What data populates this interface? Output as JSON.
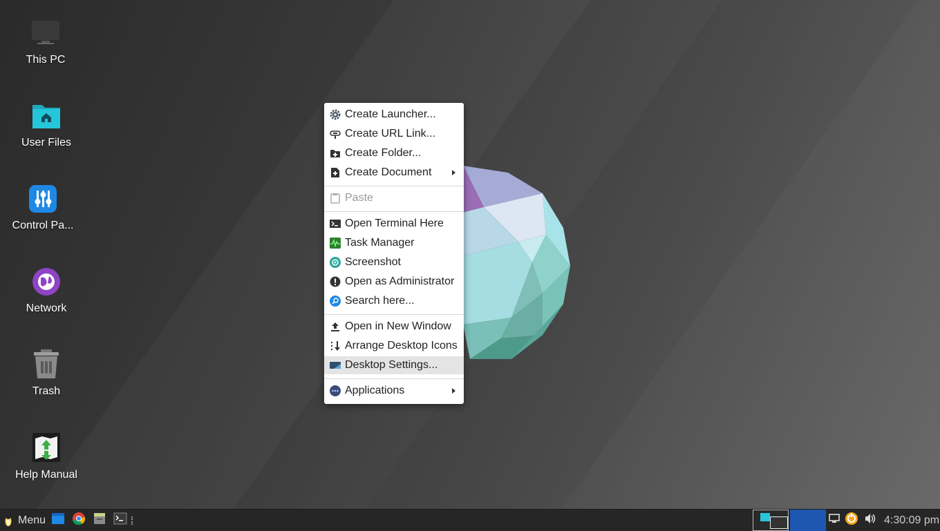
{
  "desktop": {
    "icons": [
      {
        "label": "This PC",
        "icon": "computer-icon"
      },
      {
        "label": "User Files",
        "icon": "home-folder-icon"
      },
      {
        "label": "Control Pa...",
        "icon": "control-panel-icon"
      },
      {
        "label": "Network",
        "icon": "network-globe-icon"
      },
      {
        "label": "Trash",
        "icon": "trash-icon"
      },
      {
        "label": "Help Manual",
        "icon": "help-manual-icon"
      }
    ]
  },
  "context_menu": {
    "items": [
      {
        "label": "Create Launcher...",
        "icon": "gear-icon"
      },
      {
        "label": "Create URL Link...",
        "icon": "link-icon"
      },
      {
        "label": "Create Folder...",
        "icon": "new-folder-icon"
      },
      {
        "label": "Create Document",
        "icon": "new-document-icon",
        "submenu": true
      },
      {
        "label": "Paste",
        "icon": "clipboard-icon",
        "disabled": true
      },
      {
        "label": "Open Terminal Here",
        "icon": "terminal-icon"
      },
      {
        "label": "Task Manager",
        "icon": "task-manager-icon"
      },
      {
        "label": "Screenshot",
        "icon": "screenshot-icon"
      },
      {
        "label": "Open as Administrator",
        "icon": "admin-icon"
      },
      {
        "label": "Search here...",
        "icon": "search-icon"
      },
      {
        "label": "Open in New Window",
        "icon": "open-window-icon"
      },
      {
        "label": "Arrange Desktop Icons",
        "icon": "arrange-icon"
      },
      {
        "label": "Desktop Settings...",
        "icon": "desktop-settings-icon",
        "highlighted": true
      },
      {
        "label": "Applications",
        "icon": "applications-icon",
        "submenu": true
      }
    ]
  },
  "taskbar": {
    "menu_label": "Menu",
    "clock": "4:30:09 pm",
    "launchers": [
      "file-manager-icon",
      "chrome-icon",
      "files-icon",
      "terminal-icon"
    ],
    "tray": [
      "display-icon",
      "update-icon",
      "volume-icon"
    ]
  },
  "colors": {
    "accent_blue": "#1565c0",
    "teal_folder": "#26c6da",
    "control_blue": "#1e88e5",
    "network_purple": "#8e44c4"
  }
}
